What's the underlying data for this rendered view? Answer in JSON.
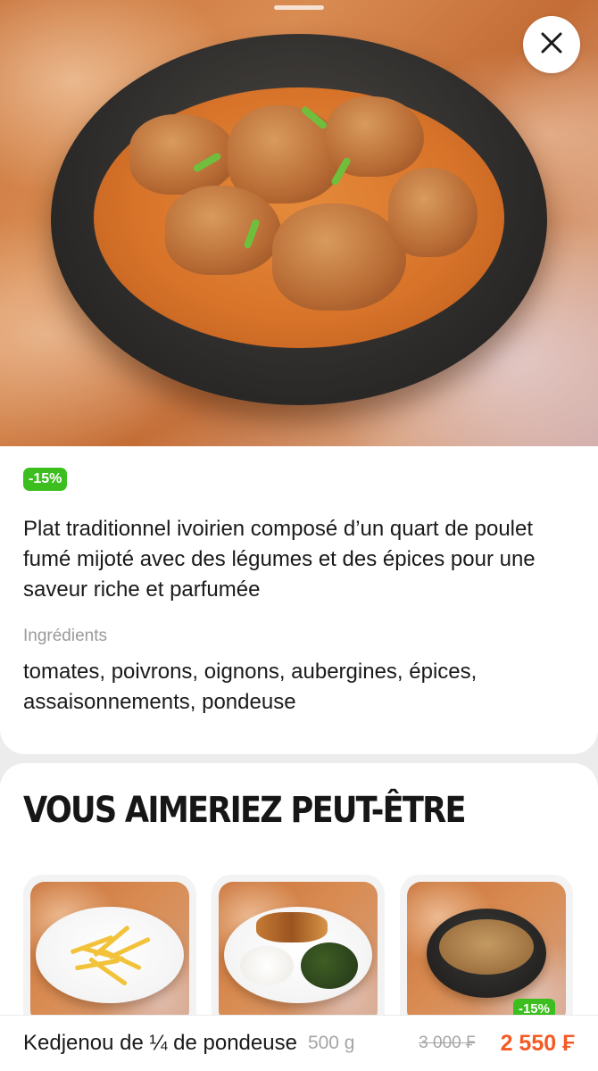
{
  "hero": {
    "image_alt": "Kedjenou"
  },
  "close": {
    "icon": "close-icon"
  },
  "info": {
    "discount_badge": "-15%",
    "description": "Plat traditionnel ivoirien composé d’un quart de poulet fumé mijoté avec des légumes et des épices pour une saveur riche et parfumée",
    "ingredients_title": "Ingrédients",
    "ingredients_text": "tomates, poivrons, oignons, aubergines, épices, assaisonnements, pondeuse"
  },
  "suggestions": {
    "title": "VOUS AIMERIEZ PEUT-ÊTRE",
    "items": [
      {
        "image": "fries-plate"
      },
      {
        "image": "fish-rice-greens-plate"
      },
      {
        "image": "stew-bowl",
        "badge": "-15%"
      }
    ]
  },
  "bottom_bar": {
    "product_name": "Kedjenou de ¼ de pondeuse",
    "weight": "500 g",
    "old_price": "3 000 ₣",
    "new_price": "2 550 ₣"
  },
  "colors": {
    "accent_green": "#3cbf1e",
    "price_orange": "#f45a24"
  }
}
